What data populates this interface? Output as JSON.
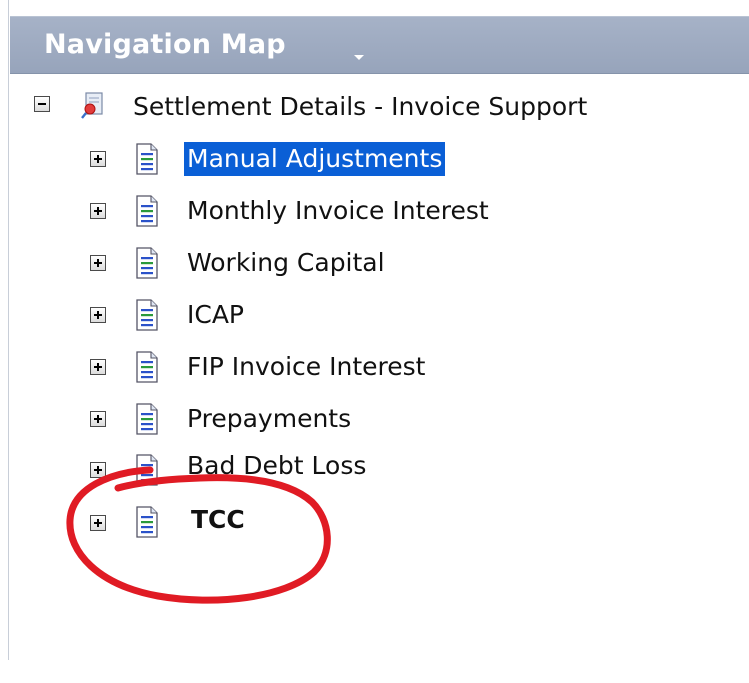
{
  "header": {
    "title": "Navigation Map",
    "menu_icon": "caret-down-icon"
  },
  "tree": {
    "root": {
      "label": "Settlement Details - Invoice Support",
      "expanded": true,
      "icon": "report-pin-icon"
    },
    "children": [
      {
        "label": "Manual Adjustments",
        "selected": true,
        "icon": "document-icon"
      },
      {
        "label": "Monthly Invoice Interest",
        "icon": "document-icon"
      },
      {
        "label": "Working Capital",
        "icon": "document-icon"
      },
      {
        "label": "ICAP",
        "icon": "document-icon"
      },
      {
        "label": "FIP Invoice Interest",
        "icon": "document-icon"
      },
      {
        "label": "Prepayments",
        "icon": "document-icon"
      },
      {
        "label": "Bad Debt Loss",
        "icon": "document-icon"
      },
      {
        "label": "TCC",
        "icon": "document-icon",
        "highlighted": true
      }
    ]
  },
  "annotation": {
    "type": "hand-drawn circle",
    "color": "#e01b24"
  }
}
